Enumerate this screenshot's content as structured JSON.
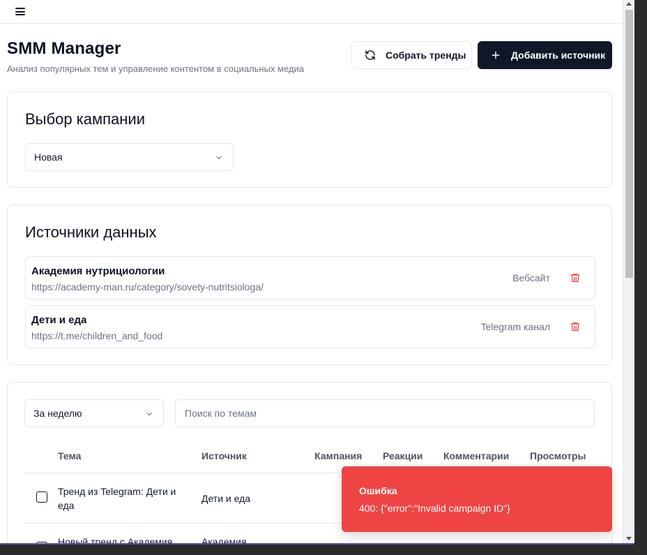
{
  "header": {
    "title": "SMM Manager",
    "subtitle": "Анализ популярных тем и управление контентом в социальных медиа"
  },
  "toolbar": {
    "collect_trends_label": "Собрать тренды",
    "add_source_label": "Добавить источник"
  },
  "campaign": {
    "title": "Выбор кампании",
    "selected": "Новая"
  },
  "sources": {
    "title": "Источники данных",
    "items": [
      {
        "name": "Академия нутрициологии",
        "url": "https://academy-man.ru/category/sovety-nutritsiologa/",
        "type": "Вебсайт"
      },
      {
        "name": "Дети и еда",
        "url": "https://t.me/children_and_food",
        "type": "Telegram канал"
      }
    ]
  },
  "trends": {
    "period_selected": "За неделю",
    "search_placeholder": "Поиск по темам",
    "columns": [
      "Тема",
      "Источник",
      "Кампания",
      "Реакции",
      "Комментарии",
      "Просмотры"
    ],
    "rows": [
      {
        "topic": "Тренд из Telegram: Дети и еда",
        "source": "Дети и еда"
      },
      {
        "topic": "Новый тренд с Академия",
        "source": "Академия"
      }
    ]
  },
  "toast": {
    "title": "Ошибка",
    "message": "400: {\"error\":\"Invalid campaign ID\"}"
  },
  "colors": {
    "primary_dark": "#0f172a",
    "danger": "#ef4444",
    "border": "#e5e7eb",
    "muted_text": "#6b7280"
  }
}
